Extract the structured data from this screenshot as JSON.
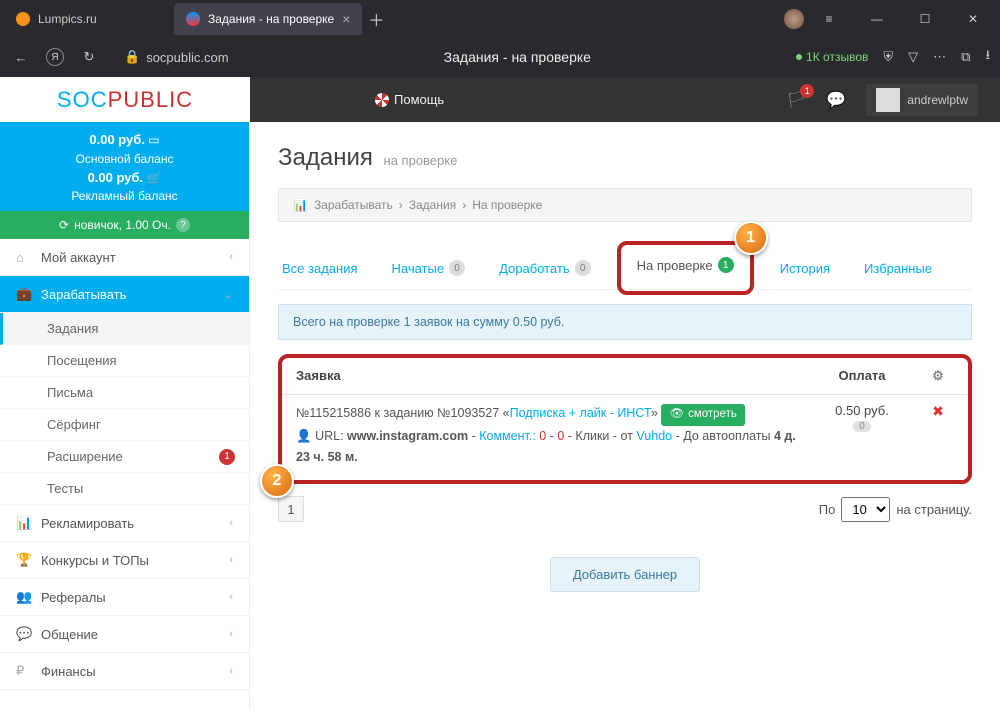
{
  "browser": {
    "tabs": [
      {
        "title": "Lumpics.ru",
        "active": false
      },
      {
        "title": "Задания - на проверке",
        "active": true
      }
    ],
    "url_host": "socpublic.com",
    "page_title": "Задания - на проверке",
    "reviews": "1К отзывов"
  },
  "header": {
    "logo_a": "SOC",
    "logo_b": "PUBLIC",
    "help": "Помощь",
    "notifications": "1",
    "username": "andrewlptw"
  },
  "balance": {
    "main_amount": "0.00 руб.",
    "main_label": "Основной баланс",
    "ad_amount": "0.00 руб.",
    "ad_label": "Рекламный баланс",
    "rank": "новичок, 1.00 Оч."
  },
  "menu": {
    "account": "Мой аккаунт",
    "earn": "Зарабатывать",
    "sub": [
      "Задания",
      "Посещения",
      "Письма",
      "Сёрфинг",
      "Расширение",
      "Тесты"
    ],
    "ext_badge": "1",
    "others": [
      "Рекламировать",
      "Конкурсы и ТОПы",
      "Рефералы",
      "Общение",
      "Финансы"
    ]
  },
  "page": {
    "title": "Задания",
    "subtitle": "на проверке",
    "crumb_root": "Зарабатывать",
    "crumb_mid": "Задания",
    "crumb_last": "На проверке"
  },
  "tabs": {
    "all": "Все задания",
    "started": "Начатые",
    "started_n": "0",
    "rework": "Доработать",
    "rework_n": "0",
    "review": "На проверке",
    "review_n": "1",
    "history": "История",
    "fav": "Избранные"
  },
  "info": "Всего на проверке 1 заявок на сумму 0.50 руб.",
  "table": {
    "h1": "Заявка",
    "h2": "Оплата",
    "req_no": "№115215886 к заданию №1093527 «",
    "req_link": "Подписка + лайк - ИНСТ",
    "req_close": "»",
    "view": "смотреть",
    "url_label": "URL:",
    "url": "www.instagram.com",
    "comm_label": "Коммент.:",
    "comm_v": "0",
    "comm_sep": " - ",
    "comm_v2": "0",
    "clicks": "Клики",
    "from": "от",
    "user": "Vuhdo",
    "auto_label": "До автооплаты",
    "auto_time": "4 д. 23 ч. 58 м.",
    "pay": "0.50 руб.",
    "pay_badge": "0"
  },
  "pager": {
    "page": "1",
    "per_label_a": "По",
    "per_value": "10",
    "per_label_b": "на страницу."
  },
  "add_banner": "Добавить баннер",
  "callouts": {
    "c1": "1",
    "c2": "2"
  }
}
